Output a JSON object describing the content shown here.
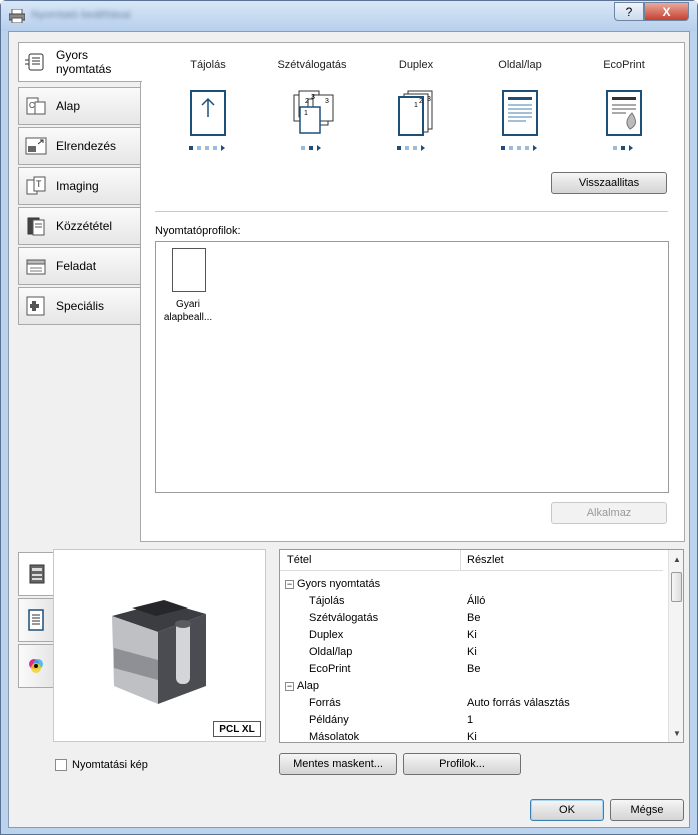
{
  "window": {
    "title": "Nyomtató beállításai",
    "help_label": "?",
    "close_label": "X"
  },
  "tabs": [
    {
      "label": "Gyors nyomtatás",
      "icon": "quick-print-icon"
    },
    {
      "label": "Alap",
      "icon": "basic-icon"
    },
    {
      "label": "Elrendezés",
      "icon": "layout-icon"
    },
    {
      "label": "Imaging",
      "icon": "imaging-icon"
    },
    {
      "label": "Közzététel",
      "icon": "publishing-icon"
    },
    {
      "label": "Feladat",
      "icon": "job-icon"
    },
    {
      "label": "Speciális",
      "icon": "advanced-icon"
    }
  ],
  "features": [
    {
      "label": "Tájolás",
      "icon": "orientation-icon"
    },
    {
      "label": "Szétválogatás",
      "icon": "collate-icon"
    },
    {
      "label": "Duplex",
      "icon": "duplex-icon"
    },
    {
      "label": "Oldal/lap",
      "icon": "pages-per-sheet-icon"
    },
    {
      "label": "EcoPrint",
      "icon": "ecoprint-icon"
    }
  ],
  "reset_label": "Visszaallitas",
  "profiles": {
    "label": "Nyomtatóprofilok:",
    "items": [
      {
        "name": "Gyari alapbeall..."
      }
    ]
  },
  "apply_label": "Alkalmaz",
  "preview": {
    "badge": "PCL XL",
    "checkbox_label": "Nyomtatási kép"
  },
  "summary": {
    "headers": [
      "Tétel",
      "Részlet"
    ],
    "rows": [
      {
        "item": "Gyors nyomtatás",
        "detail": "",
        "group": true
      },
      {
        "item": "Tájolás",
        "detail": "Álló"
      },
      {
        "item": "Szétválogatás",
        "detail": "Be"
      },
      {
        "item": "Duplex",
        "detail": "Ki"
      },
      {
        "item": "Oldal/lap",
        "detail": "Ki"
      },
      {
        "item": "EcoPrint",
        "detail": "Be"
      },
      {
        "item": "Alap",
        "detail": "",
        "group": true
      },
      {
        "item": "Forrás",
        "detail": "Auto forrás választás"
      },
      {
        "item": "Példány",
        "detail": "1"
      },
      {
        "item": "Másolatok",
        "detail": "Ki"
      }
    ]
  },
  "buttons": {
    "save_as": "Mentes maskent...",
    "profiles": "Profilok...",
    "ok": "OK",
    "cancel": "Mégse"
  }
}
